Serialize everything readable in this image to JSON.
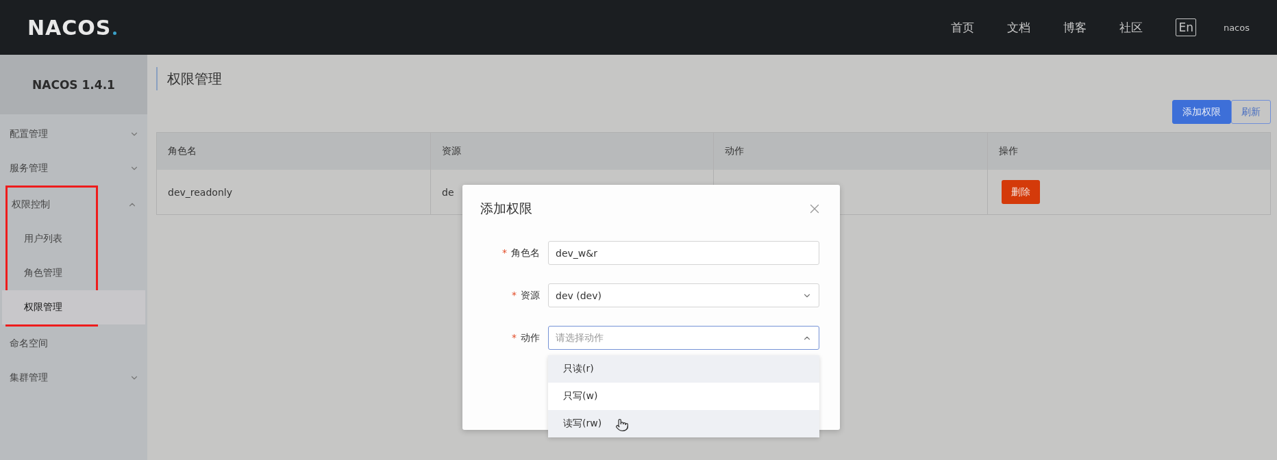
{
  "header": {
    "logo": "NACOS",
    "nav": [
      "首页",
      "文档",
      "博客",
      "社区"
    ],
    "language": "En",
    "user": "nacos"
  },
  "sidebar": {
    "title": "NACOS 1.4.1",
    "items": [
      {
        "label": "配置管理",
        "kind": "group",
        "expanded": false,
        "selected": false
      },
      {
        "label": "服务管理",
        "kind": "group",
        "expanded": false,
        "selected": false
      },
      {
        "label": "权限控制",
        "kind": "group",
        "expanded": true,
        "selected": false,
        "highlighted": true,
        "children": [
          {
            "label": "用户列表",
            "kind": "link",
            "selected": false
          },
          {
            "label": "角色管理",
            "kind": "link",
            "selected": false
          },
          {
            "label": "权限管理",
            "kind": "link",
            "selected": true
          }
        ]
      },
      {
        "label": "命名空间",
        "kind": "link",
        "selected": false
      },
      {
        "label": "集群管理",
        "kind": "group",
        "expanded": false,
        "selected": false
      }
    ]
  },
  "page": {
    "title": "权限管理",
    "buttons": [
      {
        "label": "添加权限",
        "kind": "primary"
      },
      {
        "label": "刷新",
        "kind": "secondary"
      }
    ]
  },
  "table": {
    "columns": [
      "角色名",
      "资源",
      "动作",
      "操作"
    ],
    "rows": [
      {
        "cells": [
          "dev_readonly",
          "de"
        ],
        "action": "删除"
      }
    ]
  },
  "dialog": {
    "title": "添加权限",
    "fields": [
      {
        "label": "角色名",
        "kind": "text",
        "value": "dev_w&r",
        "required_mark": "*"
      },
      {
        "label": "资源",
        "kind": "select",
        "value": "dev (dev)",
        "required_mark": "*",
        "open": false
      },
      {
        "label": "动作",
        "kind": "select",
        "placeholder": "请选择动作",
        "required_mark": "*",
        "open": true,
        "options": [
          {
            "label": "只读(r)",
            "highlighted": true,
            "hovered": false
          },
          {
            "label": "只写(w)",
            "highlighted": false,
            "hovered": false
          },
          {
            "label": "读写(rw)",
            "highlighted": true,
            "hovered": true
          }
        ]
      }
    ]
  }
}
